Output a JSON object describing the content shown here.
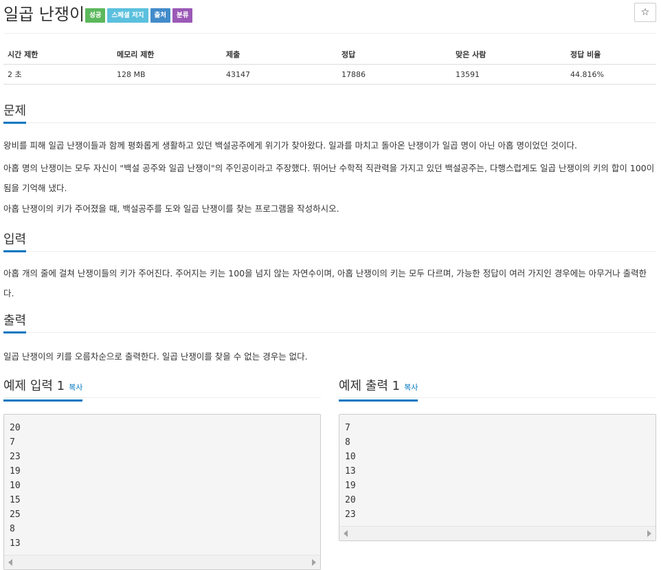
{
  "problem": {
    "title": "일곱 난쟁이",
    "labels": [
      "성공",
      "스페셜 저지",
      "출처",
      "분류"
    ],
    "star_icon": "☆"
  },
  "info_table": {
    "headers": [
      "시간 제한",
      "메모리 제한",
      "제출",
      "정답",
      "맞은 사람",
      "정답 비율"
    ],
    "row": [
      "2 초",
      "128 MB",
      "43147",
      "17886",
      "13591",
      "44.816%"
    ]
  },
  "description": {
    "heading": "문제",
    "paragraphs": [
      "왕비를 피해 일곱 난쟁이들과 함께 평화롭게 생활하고 있던 백설공주에게 위기가 찾아왔다. 일과를 마치고 돌아온 난쟁이가 일곱 명이 아닌 아홉 명이었던 것이다.",
      "아홉 명의 난쟁이는 모두 자신이 \"백설 공주와 일곱 난쟁이\"의 주인공이라고 주장했다. 뛰어난 수학적 직관력을 가지고 있던 백설공주는, 다행스럽게도 일곱 난쟁이의 키의 합이 100이 됨을 기억해 냈다.",
      "아홉 난쟁이의 키가 주어졌을 때, 백설공주를 도와 일곱 난쟁이를 찾는 프로그램을 작성하시오."
    ]
  },
  "input_section": {
    "heading": "입력",
    "text": "아홉 개의 줄에 걸쳐 난쟁이들의 키가 주어진다. 주어지는 키는 100을 넘지 않는 자연수이며, 아홉 난쟁이의 키는 모두 다르며, 가능한 정답이 여러 가지인 경우에는 아무거나 출력한다."
  },
  "output_section": {
    "heading": "출력",
    "text": "일곱 난쟁이의 키를 오름차순으로 출력한다. 일곱 난쟁이를 찾을 수 없는 경우는 없다."
  },
  "sample_input": {
    "heading": "예제 입력 1",
    "copy_label": "복사",
    "content": "20\n7\n23\n19\n10\n15\n25\n8\n13"
  },
  "sample_output": {
    "heading": "예제 출력 1",
    "copy_label": "복사",
    "content": "7\n8\n10\n13\n19\n20\n23"
  },
  "colors": {
    "accent": "#0076c0",
    "label_success": "#5cb85c",
    "label_special": "#5bc0de",
    "label_source": "#428bca",
    "label_tags": "#9b59b6"
  }
}
